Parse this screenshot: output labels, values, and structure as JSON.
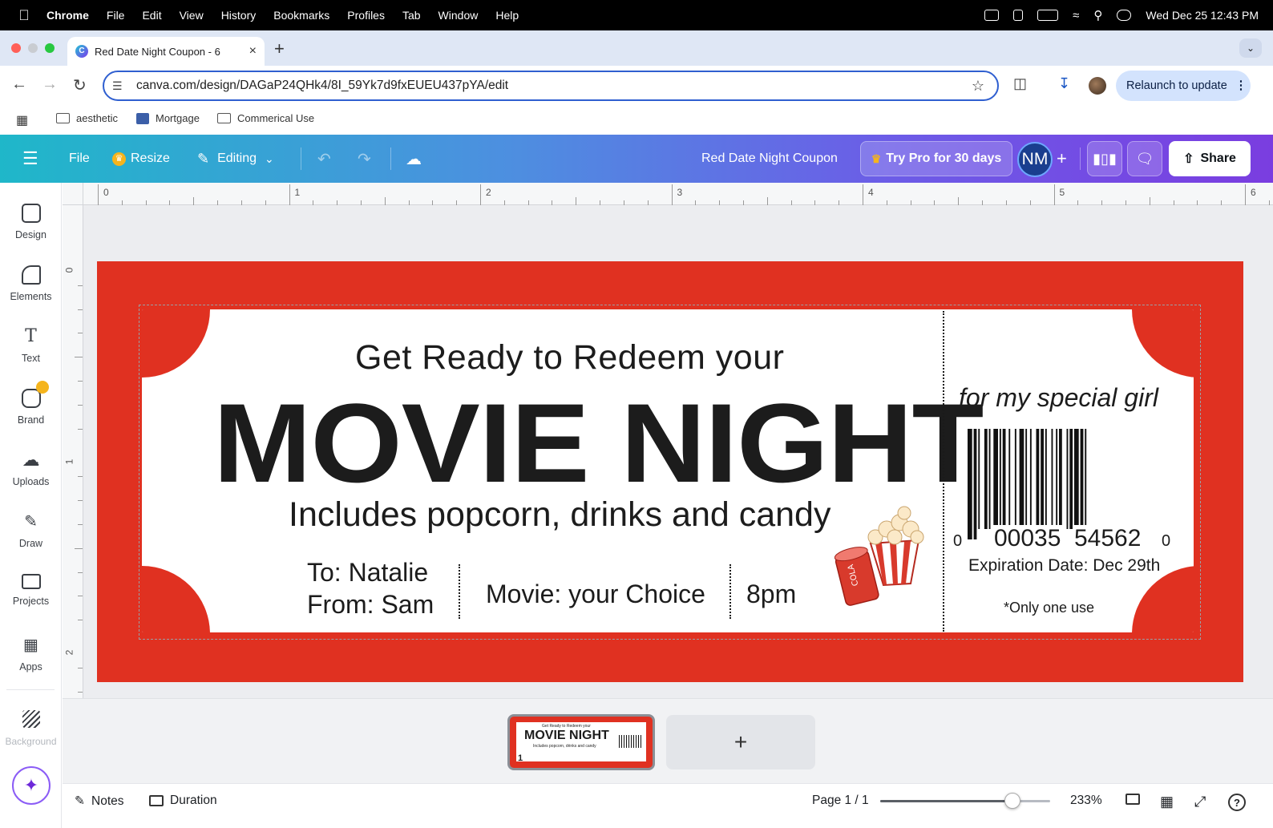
{
  "menubar": {
    "app": "Chrome",
    "items": [
      "File",
      "Edit",
      "View",
      "History",
      "Bookmarks",
      "Profiles",
      "Tab",
      "Window",
      "Help"
    ],
    "datetime": "Wed Dec 25  12:43 PM"
  },
  "browser": {
    "tab_title": "Red Date Night Coupon - 6",
    "url": "canva.com/design/DAGaP24QHk4/8I_59Yk7d9fxEUEU437pYA/edit",
    "relaunch_label": "Relaunch to update"
  },
  "bookmarks": [
    {
      "label": "aesthetic",
      "icon": "folder-icon"
    },
    {
      "label": "Mortgage",
      "icon": "site-icon"
    },
    {
      "label": "Commerical Use",
      "icon": "folder-icon"
    }
  ],
  "canva_header": {
    "file_label": "File",
    "resize_label": "Resize",
    "editing_label": "Editing",
    "doc_title": "Red Date Night Coupon",
    "try_pro_label": "Try Pro for 30 days",
    "avatar_initials": "NM",
    "share_label": "Share"
  },
  "left_rail": [
    {
      "label": "Design",
      "icon": "design-icon"
    },
    {
      "label": "Elements",
      "icon": "elements-icon"
    },
    {
      "label": "Text",
      "icon": "text-icon"
    },
    {
      "label": "Brand",
      "icon": "brand-icon"
    },
    {
      "label": "Uploads",
      "icon": "uploads-icon"
    },
    {
      "label": "Draw",
      "icon": "draw-icon"
    },
    {
      "label": "Projects",
      "icon": "projects-icon"
    },
    {
      "label": "Apps",
      "icon": "apps-icon"
    },
    {
      "label": "Background",
      "icon": "background-icon"
    }
  ],
  "rulers": {
    "top": [
      "0",
      "1",
      "2",
      "3",
      "4",
      "5",
      "6"
    ],
    "left": [
      "0",
      "1",
      "2"
    ]
  },
  "ticket": {
    "headline_top": "Get Ready to Redeem your",
    "headline_main": "MOVIE NIGHT",
    "includes": "Includes popcorn, drinks and candy",
    "to": "To: Natalie",
    "from": "From: Sam",
    "movie": "Movie: your Choice",
    "time": "8pm",
    "dedication": "for my special girl",
    "barcode_left_digit": "0",
    "barcode_group1": "00035",
    "barcode_group2": "54562",
    "barcode_right_digit": "0",
    "expiration": "Expiration Date: Dec 29th",
    "only_one": "*Only one use",
    "cup_label": "COLA"
  },
  "thumbnail": {
    "page_number": "1",
    "headline_top": "Get Ready to Redeem your",
    "headline_main": "MOVIE NIGHT",
    "includes": "Includes popcorn, drinks and candy"
  },
  "footer": {
    "notes_label": "Notes",
    "duration_label": "Duration",
    "page_indicator": "Page 1 / 1",
    "zoom": "233%",
    "zoom_fraction": 0.78
  },
  "colors": {
    "ticket_red": "#e03121",
    "header_gradient_start": "#1fb7c9",
    "header_gradient_end": "#7a3de0"
  }
}
